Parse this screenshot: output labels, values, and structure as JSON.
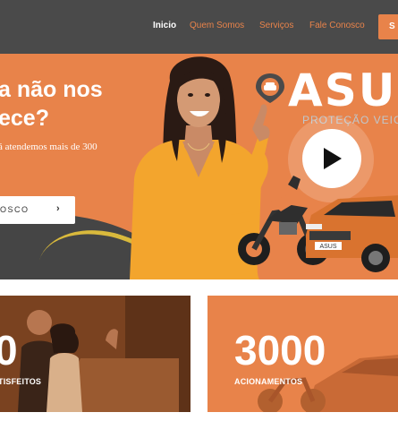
{
  "nav": {
    "items": [
      {
        "label": "Inicio"
      },
      {
        "label": "Quem Somos"
      },
      {
        "label": "Serviços"
      },
      {
        "label": "Fale Conosco"
      }
    ],
    "cta_label": "S"
  },
  "hero": {
    "title_line1": "a não nos",
    "title_line2": "ece?",
    "subtitle": "á atendemos mais de 300",
    "button_label": "OSCO",
    "button_arrow": "›",
    "logo_text": "ASUS",
    "logo_subtitle": "PROTEÇÃO VEICU",
    "plate_text": "ASUS"
  },
  "stats": [
    {
      "value": "0",
      "label": "TISFEITOS"
    },
    {
      "value": "3000",
      "label": "ACIONAMENTOS"
    }
  ],
  "colors": {
    "brand_orange": "#e8834a",
    "nav_dark": "#4a4a4a",
    "accent_yellow": "#f3a52d"
  }
}
